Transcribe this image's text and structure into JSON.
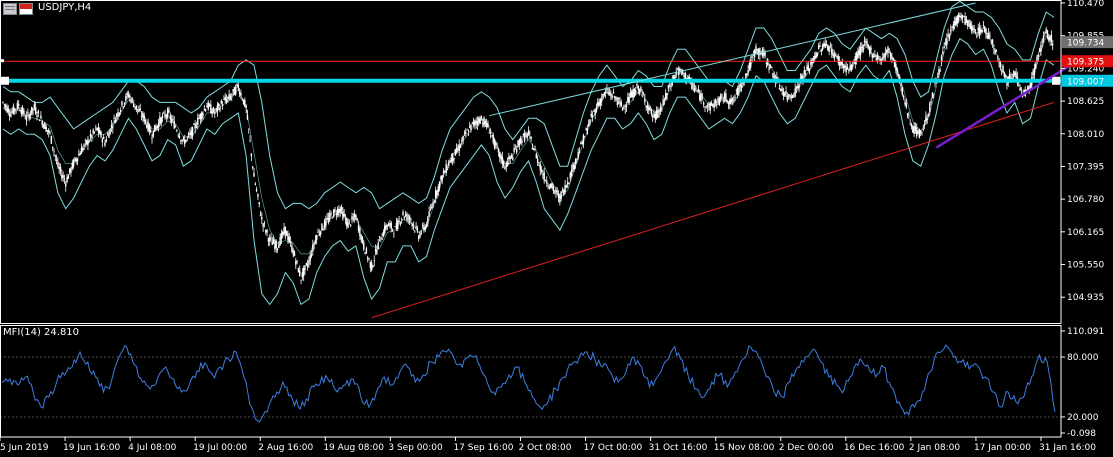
{
  "header": {
    "symbol_label": "USDJPY,H4"
  },
  "indicator": {
    "label": "MFI(14) 24.810"
  },
  "colors": {
    "background": "#000000",
    "frame": "#ffffff",
    "candles": "#ffffff",
    "bands": "#7fdde0",
    "trend_up": "#00d0ff",
    "h_line_cyan": "#00d8e8",
    "h_line_red": "#ff2020",
    "support_line": "#e02020",
    "purple_line": "#7a1ed0",
    "mfi_line": "#3e7ee0",
    "price_tag_gray": "#707070",
    "price_tag_red": "#e01010",
    "price_tag_cyan": "#00c8e0"
  },
  "chart_data": [
    {
      "type": "line",
      "name": "price",
      "x_ticks": [
        "5 Jun 2019",
        "19 Jun 16:00",
        "4 Jul 08:00",
        "19 Jul 00:00",
        "2 Aug 16:00",
        "19 Aug 08:00",
        "3 Sep 00:00",
        "17 Sep 16:00",
        "2 Oct 08:00",
        "17 Oct 00:00",
        "31 Oct 16:00",
        "15 Nov 08:00",
        "2 Dec 00:00",
        "16 Dec 16:00",
        "2 Jan 08:00",
        "17 Jan 00:00",
        "31 Jan 16:00"
      ],
      "y_ticks": [
        "110.470",
        "109.855",
        "109.240",
        "108.625",
        "108.010",
        "107.395",
        "106.780",
        "106.165",
        "105.550",
        "104.935"
      ],
      "ylim": [
        104.45,
        110.47
      ],
      "price_tags": [
        {
          "label": "109.734",
          "value": 109.734,
          "color": "#707070"
        },
        {
          "label": "109.375",
          "value": 109.375,
          "color": "#e01010"
        },
        {
          "label": "109.007",
          "value": 109.007,
          "color": "#00c8e0"
        }
      ],
      "close_series": [
        108.6,
        108.4,
        108.55,
        108.3,
        108.5,
        108.25,
        108.0,
        107.4,
        107.1,
        107.45,
        107.7,
        107.9,
        108.1,
        107.85,
        108.2,
        108.5,
        108.75,
        108.5,
        108.3,
        108.0,
        108.25,
        108.4,
        108.15,
        107.85,
        108.0,
        108.3,
        108.55,
        108.4,
        108.6,
        108.7,
        108.9,
        108.5,
        107.2,
        106.4,
        106.0,
        105.9,
        106.2,
        105.8,
        105.3,
        105.6,
        106.1,
        106.3,
        106.5,
        106.6,
        106.3,
        106.45,
        105.9,
        105.5,
        106.0,
        106.3,
        106.2,
        106.5,
        106.4,
        106.1,
        106.3,
        106.8,
        107.2,
        107.5,
        107.7,
        108.0,
        108.2,
        108.3,
        108.1,
        107.7,
        107.4,
        107.6,
        107.9,
        108.0,
        107.6,
        107.2,
        107.0,
        106.8,
        107.1,
        107.5,
        107.9,
        108.3,
        108.6,
        108.8,
        108.7,
        108.5,
        108.7,
        108.9,
        108.6,
        108.3,
        108.5,
        108.9,
        109.2,
        109.1,
        108.9,
        108.7,
        108.5,
        108.6,
        108.7,
        108.6,
        108.9,
        109.2,
        109.6,
        109.5,
        109.2,
        108.9,
        108.7,
        108.8,
        109.1,
        109.3,
        109.6,
        109.7,
        109.5,
        109.3,
        109.2,
        109.5,
        109.7,
        109.5,
        109.4,
        109.6,
        109.2,
        108.6,
        108.1,
        108.0,
        108.4,
        109.0,
        109.6,
        110.0,
        110.25,
        110.1,
        109.9,
        110.0,
        109.8,
        109.4,
        109.0,
        109.2,
        108.7,
        108.9,
        109.5,
        109.9,
        109.73
      ],
      "upper_band": [
        108.9,
        108.8,
        108.8,
        108.7,
        108.6,
        108.6,
        108.7,
        108.5,
        108.3,
        108.1,
        108.2,
        108.3,
        108.4,
        108.5,
        108.6,
        108.8,
        109.0,
        109.0,
        108.9,
        108.7,
        108.6,
        108.6,
        108.6,
        108.5,
        108.4,
        108.5,
        108.7,
        108.8,
        108.9,
        109.0,
        109.3,
        109.4,
        109.3,
        108.6,
        107.6,
        106.9,
        106.6,
        106.7,
        106.7,
        106.6,
        106.7,
        106.9,
        107.0,
        107.1,
        107.0,
        106.9,
        107.0,
        106.9,
        106.6,
        106.7,
        106.8,
        106.9,
        106.8,
        106.7,
        106.8,
        107.2,
        107.7,
        108.1,
        108.3,
        108.5,
        108.7,
        108.8,
        108.7,
        108.5,
        108.1,
        107.9,
        108.1,
        108.3,
        108.3,
        108.2,
        107.8,
        107.4,
        107.4,
        107.9,
        108.4,
        108.8,
        109.1,
        109.3,
        109.1,
        108.9,
        109.0,
        109.2,
        109.1,
        108.9,
        108.9,
        109.3,
        109.6,
        109.6,
        109.4,
        109.2,
        109.0,
        109.0,
        109.0,
        108.9,
        109.2,
        109.6,
        110.0,
        110.0,
        109.8,
        109.5,
        109.2,
        109.2,
        109.4,
        109.6,
        109.9,
        110.0,
        109.9,
        109.7,
        109.6,
        109.8,
        110.0,
        109.9,
        109.8,
        109.9,
        109.8,
        109.5,
        109.0,
        108.7,
        108.8,
        109.4,
        110.0,
        110.4,
        110.5,
        110.4,
        110.3,
        110.3,
        110.2,
        110.0,
        109.7,
        109.6,
        109.4,
        109.4,
        109.9,
        110.3,
        110.2
      ],
      "lower_band": [
        108.1,
        108.0,
        108.1,
        108.0,
        108.0,
        107.9,
        107.6,
        106.9,
        106.6,
        106.8,
        107.1,
        107.4,
        107.6,
        107.5,
        107.7,
        108.0,
        108.3,
        108.1,
        107.8,
        107.5,
        107.6,
        107.9,
        107.8,
        107.4,
        107.5,
        107.8,
        108.1,
        108.0,
        108.2,
        108.3,
        108.4,
        107.6,
        106.0,
        105.0,
        104.8,
        105.0,
        105.4,
        105.2,
        104.8,
        104.9,
        105.4,
        105.7,
        105.9,
        106.0,
        105.8,
        105.9,
        105.3,
        104.9,
        105.1,
        105.6,
        105.6,
        105.9,
        105.9,
        105.6,
        105.7,
        106.2,
        106.6,
        107.0,
        107.2,
        107.4,
        107.6,
        107.8,
        107.6,
        107.1,
        106.8,
        107.0,
        107.3,
        107.5,
        107.1,
        106.6,
        106.4,
        106.2,
        106.5,
        106.9,
        107.3,
        107.7,
        108.0,
        108.3,
        108.3,
        108.1,
        108.2,
        108.4,
        108.2,
        107.9,
        108.0,
        108.4,
        108.7,
        108.7,
        108.5,
        108.3,
        108.1,
        108.2,
        108.3,
        108.2,
        108.4,
        108.7,
        109.1,
        109.0,
        108.7,
        108.4,
        108.2,
        108.3,
        108.6,
        108.9,
        109.2,
        109.3,
        109.1,
        108.9,
        108.8,
        109.1,
        109.3,
        109.1,
        109.0,
        109.2,
        108.7,
        108.0,
        107.5,
        107.4,
        107.8,
        108.4,
        109.1,
        109.5,
        109.8,
        109.7,
        109.5,
        109.6,
        109.3,
        108.8,
        108.4,
        108.6,
        108.2,
        108.3,
        108.9,
        109.4,
        109.3
      ]
    },
    {
      "type": "line",
      "name": "MFI",
      "y_ticks": [
        "110.091",
        "80.000",
        "20.000",
        "-0.098"
      ],
      "ylim": [
        -0.098,
        110.091
      ],
      "levels": [
        80,
        20
      ],
      "values": [
        55,
        58,
        52,
        60,
        45,
        30,
        40,
        55,
        62,
        70,
        85,
        75,
        60,
        45,
        55,
        80,
        90,
        72,
        55,
        48,
        60,
        70,
        58,
        45,
        52,
        66,
        74,
        62,
        70,
        78,
        85,
        60,
        30,
        15,
        25,
        40,
        55,
        42,
        30,
        38,
        50,
        60,
        55,
        45,
        52,
        58,
        40,
        30,
        45,
        60,
        52,
        65,
        70,
        55,
        62,
        75,
        80,
        85,
        78,
        70,
        82,
        75,
        60,
        45,
        50,
        62,
        70,
        55,
        40,
        30,
        35,
        48,
        60,
        72,
        80,
        85,
        78,
        70,
        65,
        55,
        65,
        80,
        70,
        50,
        60,
        75,
        88,
        78,
        60,
        48,
        40,
        55,
        62,
        50,
        65,
        78,
        90,
        80,
        60,
        45,
        40,
        55,
        70,
        80,
        88,
        75,
        60,
        52,
        48,
        62,
        78,
        72,
        60,
        70,
        50,
        35,
        25,
        30,
        45,
        65,
        85,
        92,
        80,
        75,
        68,
        72,
        60,
        45,
        30,
        45,
        35,
        40,
        60,
        82,
        75,
        25
      ]
    }
  ]
}
